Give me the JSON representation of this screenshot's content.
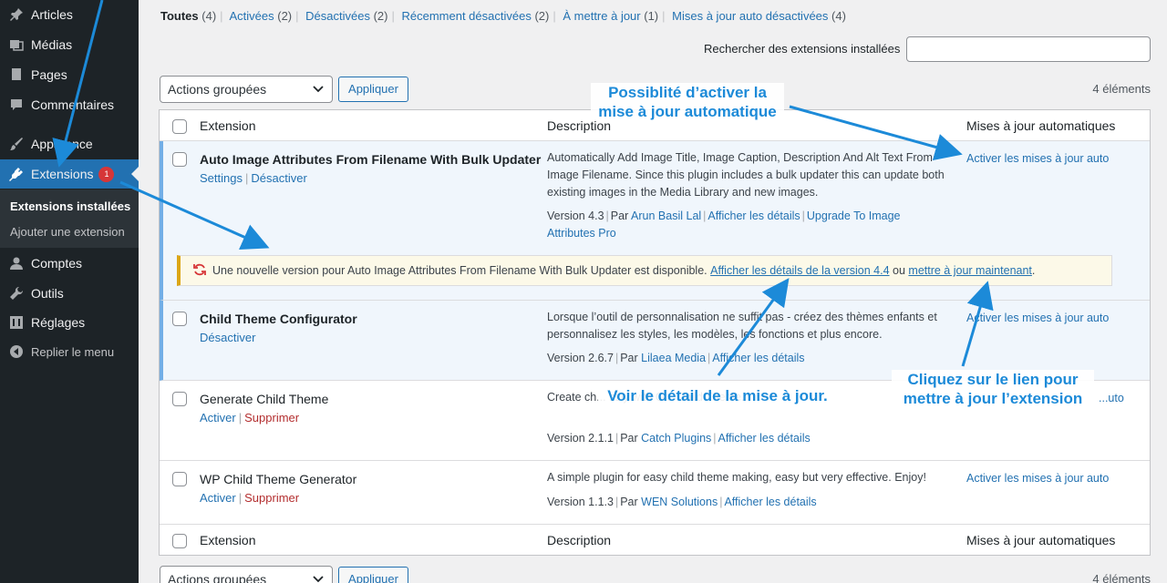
{
  "sidebar": {
    "items": [
      {
        "label": "Articles",
        "icon": "pin-icon"
      },
      {
        "label": "Médias",
        "icon": "media-icon"
      },
      {
        "label": "Pages",
        "icon": "pages-icon"
      },
      {
        "label": "Commentaires",
        "icon": "comment-icon"
      },
      {
        "label": "Apparence",
        "icon": "brush-icon"
      },
      {
        "label": "Extensions",
        "icon": "plugin-icon",
        "badge": "1"
      },
      {
        "label": "Comptes",
        "icon": "user-icon"
      },
      {
        "label": "Outils",
        "icon": "wrench-icon"
      },
      {
        "label": "Réglages",
        "icon": "settings-icon"
      },
      {
        "label": "Replier le menu",
        "icon": "collapse-icon"
      }
    ],
    "submenu": [
      "Extensions installées",
      "Ajouter une extension"
    ]
  },
  "filters": {
    "all": "Toutes",
    "all_count": "(4)",
    "active": "Activées",
    "active_count": "(2)",
    "inactive": "Désactivées",
    "inactive_count": "(2)",
    "recent": "Récemment désactivées",
    "recent_count": "(2)",
    "upgrade": "À mettre à jour",
    "upgrade_count": "(1)",
    "auto_off": "Mises à jour auto désactivées",
    "auto_off_count": "(4)"
  },
  "search": {
    "label": "Rechercher des extensions installées",
    "value": ""
  },
  "bulk": {
    "select": "Actions groupées",
    "apply": "Appliquer",
    "count": "4 éléments"
  },
  "table": {
    "col_extension": "Extension",
    "col_description": "Description",
    "col_auto": "Mises à jour automatiques",
    "plugins": [
      {
        "name": "Auto Image Attributes From Filename With Bulk Updater",
        "action1": "Settings",
        "action2": "Désactiver",
        "desc": "Automatically Add Image Title, Image Caption, Description And Alt Text From Image Filename. Since this plugin includes a bulk updater this can update both existing images in the Media Library and new images.",
        "version": "Version 4.3",
        "by": "Par",
        "author": "Arun Basil Lal",
        "details": "Afficher les détails",
        "extra": "Upgrade To Image Attributes Pro",
        "auto": "Activer les mises à jour auto"
      },
      {
        "name": "Child Theme Configurator",
        "action1": "Désactiver",
        "desc": "Lorsque l’outil de personnalisation ne suffit pas - créez des thèmes enfants et personnalisez les styles, les modèles, les fonctions et plus encore.",
        "version": "Version 2.6.7",
        "by": "Par",
        "author": "Lilaea Media",
        "details": "Afficher les détails",
        "auto": "Activer les mises à jour auto"
      },
      {
        "name": "Generate Child Theme",
        "action1": "Activer",
        "action2": "Supprimer",
        "desc": "Create ch... ssly with G... Child Theme.",
        "version": "Version 2.1.1",
        "by": "Par",
        "author": "Catch Plugins",
        "details": "Afficher les détails",
        "auto": "...uto"
      },
      {
        "name": "WP Child Theme Generator",
        "action1": "Activer",
        "action2": "Supprimer",
        "desc": "A simple plugin for easy child theme making, easy but very effective. Enjoy!",
        "version": "Version 1.1.3",
        "by": "Par",
        "author": "WEN Solutions",
        "details": "Afficher les détails",
        "auto": "Activer les mises à jour auto"
      }
    ]
  },
  "notice": {
    "text": "Une nouvelle version pour Auto Image Attributes From Filename With Bulk Updater est disponible.",
    "details_link": "Afficher les détails de la version 4.4",
    "or": "ou",
    "update_link": "mettre à jour maintenant",
    "end": "."
  },
  "annotations": {
    "auto_line1": "Possiblité d’activer la",
    "auto_line2": "mise à jour automatique",
    "detail": "Voir le détail de la mise à jour.",
    "click_line1": "Cliquez sur le lien pour",
    "click_line2": "mettre à jour l’extension"
  },
  "colors": {
    "accent": "#2271b1",
    "annotation": "#1c8ad8",
    "sidebar": "#1d2327",
    "error": "#d63638"
  }
}
